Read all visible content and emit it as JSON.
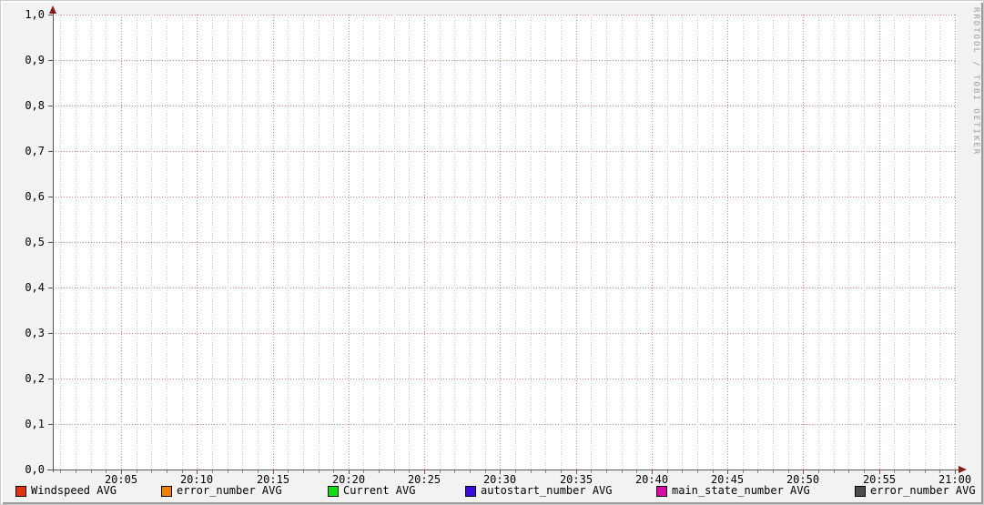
{
  "watermark": "RRDTOOL / TOBI OETIKER",
  "colors": {
    "background": "#F2F2F2",
    "plot_background": "#FFFFFF",
    "axis": "#585858",
    "arrow": "#8B1A1A",
    "major_grid": "#E07F7F",
    "minor_grid": "#CBCBCB",
    "text": "#000000",
    "watermark_text": "#9C9C9C"
  },
  "chart_data": {
    "type": "line",
    "title": "",
    "xlabel": "",
    "ylabel": "",
    "ylim": [
      0.0,
      1.0
    ],
    "y_tick_step": 0.1,
    "y_ticks": [
      "1,0",
      "0,9",
      "0,8",
      "0,7",
      "0,6",
      "0,5",
      "0,4",
      "0,3",
      "0,2",
      "0,1",
      "0,0"
    ],
    "x_ticks": [
      "20:05",
      "20:10",
      "20:15",
      "20:20",
      "20:25",
      "20:30",
      "20:35",
      "20:40",
      "20:45",
      "20:50",
      "20:55",
      "21:00"
    ],
    "x_minor_per_major": 5,
    "grid": true,
    "legend_position": "bottom",
    "series": [
      {
        "name": "Windspeed AVG",
        "color": "#E5310E",
        "values": []
      },
      {
        "name": "error_number AVG",
        "color": "#EE8100",
        "values": []
      },
      {
        "name": "Current AVG",
        "color": "#0BE30B",
        "values": []
      },
      {
        "name": "autostart_number AVG",
        "color": "#3A0BE0",
        "values": []
      },
      {
        "name": "main_state_number AVG",
        "color": "#DC07A8",
        "values": []
      },
      {
        "name": "error_number AVG",
        "color": "#4B4B4B",
        "values": []
      }
    ]
  }
}
